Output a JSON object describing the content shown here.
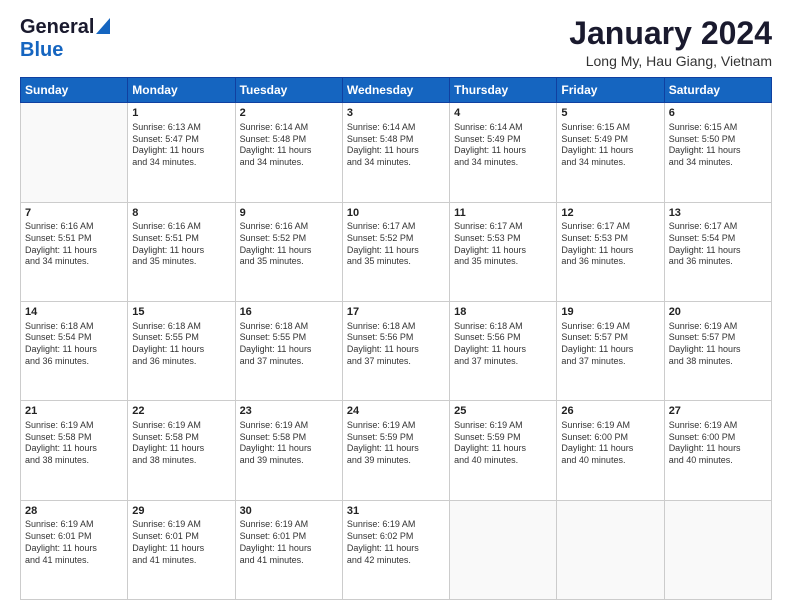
{
  "logo": {
    "line1": "General",
    "line2": "Blue"
  },
  "title": "January 2024",
  "subtitle": "Long My, Hau Giang, Vietnam",
  "weekdays": [
    "Sunday",
    "Monday",
    "Tuesday",
    "Wednesday",
    "Thursday",
    "Friday",
    "Saturday"
  ],
  "weeks": [
    [
      {
        "day": "",
        "info": ""
      },
      {
        "day": "1",
        "info": "Sunrise: 6:13 AM\nSunset: 5:47 PM\nDaylight: 11 hours\nand 34 minutes."
      },
      {
        "day": "2",
        "info": "Sunrise: 6:14 AM\nSunset: 5:48 PM\nDaylight: 11 hours\nand 34 minutes."
      },
      {
        "day": "3",
        "info": "Sunrise: 6:14 AM\nSunset: 5:48 PM\nDaylight: 11 hours\nand 34 minutes."
      },
      {
        "day": "4",
        "info": "Sunrise: 6:14 AM\nSunset: 5:49 PM\nDaylight: 11 hours\nand 34 minutes."
      },
      {
        "day": "5",
        "info": "Sunrise: 6:15 AM\nSunset: 5:49 PM\nDaylight: 11 hours\nand 34 minutes."
      },
      {
        "day": "6",
        "info": "Sunrise: 6:15 AM\nSunset: 5:50 PM\nDaylight: 11 hours\nand 34 minutes."
      }
    ],
    [
      {
        "day": "7",
        "info": "Sunrise: 6:16 AM\nSunset: 5:51 PM\nDaylight: 11 hours\nand 34 minutes."
      },
      {
        "day": "8",
        "info": "Sunrise: 6:16 AM\nSunset: 5:51 PM\nDaylight: 11 hours\nand 35 minutes."
      },
      {
        "day": "9",
        "info": "Sunrise: 6:16 AM\nSunset: 5:52 PM\nDaylight: 11 hours\nand 35 minutes."
      },
      {
        "day": "10",
        "info": "Sunrise: 6:17 AM\nSunset: 5:52 PM\nDaylight: 11 hours\nand 35 minutes."
      },
      {
        "day": "11",
        "info": "Sunrise: 6:17 AM\nSunset: 5:53 PM\nDaylight: 11 hours\nand 35 minutes."
      },
      {
        "day": "12",
        "info": "Sunrise: 6:17 AM\nSunset: 5:53 PM\nDaylight: 11 hours\nand 36 minutes."
      },
      {
        "day": "13",
        "info": "Sunrise: 6:17 AM\nSunset: 5:54 PM\nDaylight: 11 hours\nand 36 minutes."
      }
    ],
    [
      {
        "day": "14",
        "info": "Sunrise: 6:18 AM\nSunset: 5:54 PM\nDaylight: 11 hours\nand 36 minutes."
      },
      {
        "day": "15",
        "info": "Sunrise: 6:18 AM\nSunset: 5:55 PM\nDaylight: 11 hours\nand 36 minutes."
      },
      {
        "day": "16",
        "info": "Sunrise: 6:18 AM\nSunset: 5:55 PM\nDaylight: 11 hours\nand 37 minutes."
      },
      {
        "day": "17",
        "info": "Sunrise: 6:18 AM\nSunset: 5:56 PM\nDaylight: 11 hours\nand 37 minutes."
      },
      {
        "day": "18",
        "info": "Sunrise: 6:18 AM\nSunset: 5:56 PM\nDaylight: 11 hours\nand 37 minutes."
      },
      {
        "day": "19",
        "info": "Sunrise: 6:19 AM\nSunset: 5:57 PM\nDaylight: 11 hours\nand 37 minutes."
      },
      {
        "day": "20",
        "info": "Sunrise: 6:19 AM\nSunset: 5:57 PM\nDaylight: 11 hours\nand 38 minutes."
      }
    ],
    [
      {
        "day": "21",
        "info": "Sunrise: 6:19 AM\nSunset: 5:58 PM\nDaylight: 11 hours\nand 38 minutes."
      },
      {
        "day": "22",
        "info": "Sunrise: 6:19 AM\nSunset: 5:58 PM\nDaylight: 11 hours\nand 38 minutes."
      },
      {
        "day": "23",
        "info": "Sunrise: 6:19 AM\nSunset: 5:58 PM\nDaylight: 11 hours\nand 39 minutes."
      },
      {
        "day": "24",
        "info": "Sunrise: 6:19 AM\nSunset: 5:59 PM\nDaylight: 11 hours\nand 39 minutes."
      },
      {
        "day": "25",
        "info": "Sunrise: 6:19 AM\nSunset: 5:59 PM\nDaylight: 11 hours\nand 40 minutes."
      },
      {
        "day": "26",
        "info": "Sunrise: 6:19 AM\nSunset: 6:00 PM\nDaylight: 11 hours\nand 40 minutes."
      },
      {
        "day": "27",
        "info": "Sunrise: 6:19 AM\nSunset: 6:00 PM\nDaylight: 11 hours\nand 40 minutes."
      }
    ],
    [
      {
        "day": "28",
        "info": "Sunrise: 6:19 AM\nSunset: 6:01 PM\nDaylight: 11 hours\nand 41 minutes."
      },
      {
        "day": "29",
        "info": "Sunrise: 6:19 AM\nSunset: 6:01 PM\nDaylight: 11 hours\nand 41 minutes."
      },
      {
        "day": "30",
        "info": "Sunrise: 6:19 AM\nSunset: 6:01 PM\nDaylight: 11 hours\nand 41 minutes."
      },
      {
        "day": "31",
        "info": "Sunrise: 6:19 AM\nSunset: 6:02 PM\nDaylight: 11 hours\nand 42 minutes."
      },
      {
        "day": "",
        "info": ""
      },
      {
        "day": "",
        "info": ""
      },
      {
        "day": "",
        "info": ""
      }
    ]
  ]
}
